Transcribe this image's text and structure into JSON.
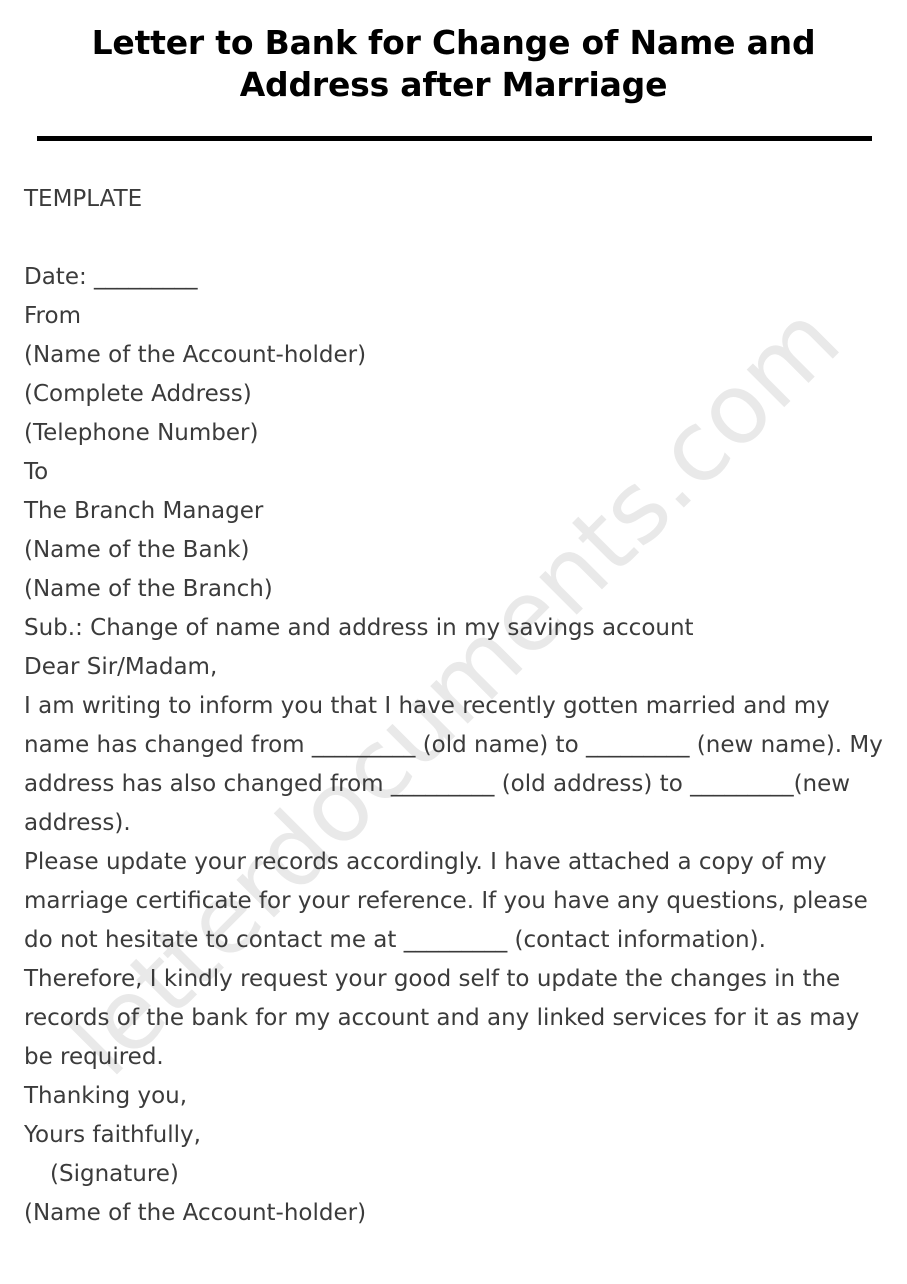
{
  "document": {
    "title_line_1": "Letter to Bank for Change of Name and",
    "title_line_2": "Address after Marriage",
    "watermark": "letterdocuments.com",
    "watermark_color": "#e9e9e9",
    "title_color": "#000000",
    "body_color": "#3b3b3b",
    "rule_color": "#000000",
    "section_label": "TEMPLATE",
    "body": {
      "date_line": "Date: _________",
      "from_label": "From",
      "sender_name": "(Name of the Account-holder)",
      "sender_address": "(Complete Address)",
      "sender_phone": "(Telephone Number)",
      "to_label": "To",
      "recipient_title": "The Branch Manager",
      "recipient_bank": "(Name of the Bank)",
      "recipient_branch": "(Name of the Branch)",
      "subject_line": "Sub.: Change of name and address in my savings account",
      "salutation": "Dear Sir/Madam,",
      "paragraph_1": "I am writing to inform you that I have recently gotten married and my name has changed from _________ (old name) to _________ (new name). My address has also changed from _________ (old address) to _________(new address).",
      "paragraph_2": "Please update your records accordingly. I have attached a copy of my marriage certificate for your reference. If you have any questions, please do not hesitate to contact me at _________ (contact information).",
      "paragraph_3": "Therefore, I kindly request your good self to update the changes in the records of the bank for my account and any linked services for it as may be required.",
      "closing_thanks": "Thanking you,",
      "closing_salutation": "Yours faithfully,",
      "signature_placeholder": "(Signature)",
      "signer_name": "(Name of the Account-holder)"
    }
  }
}
